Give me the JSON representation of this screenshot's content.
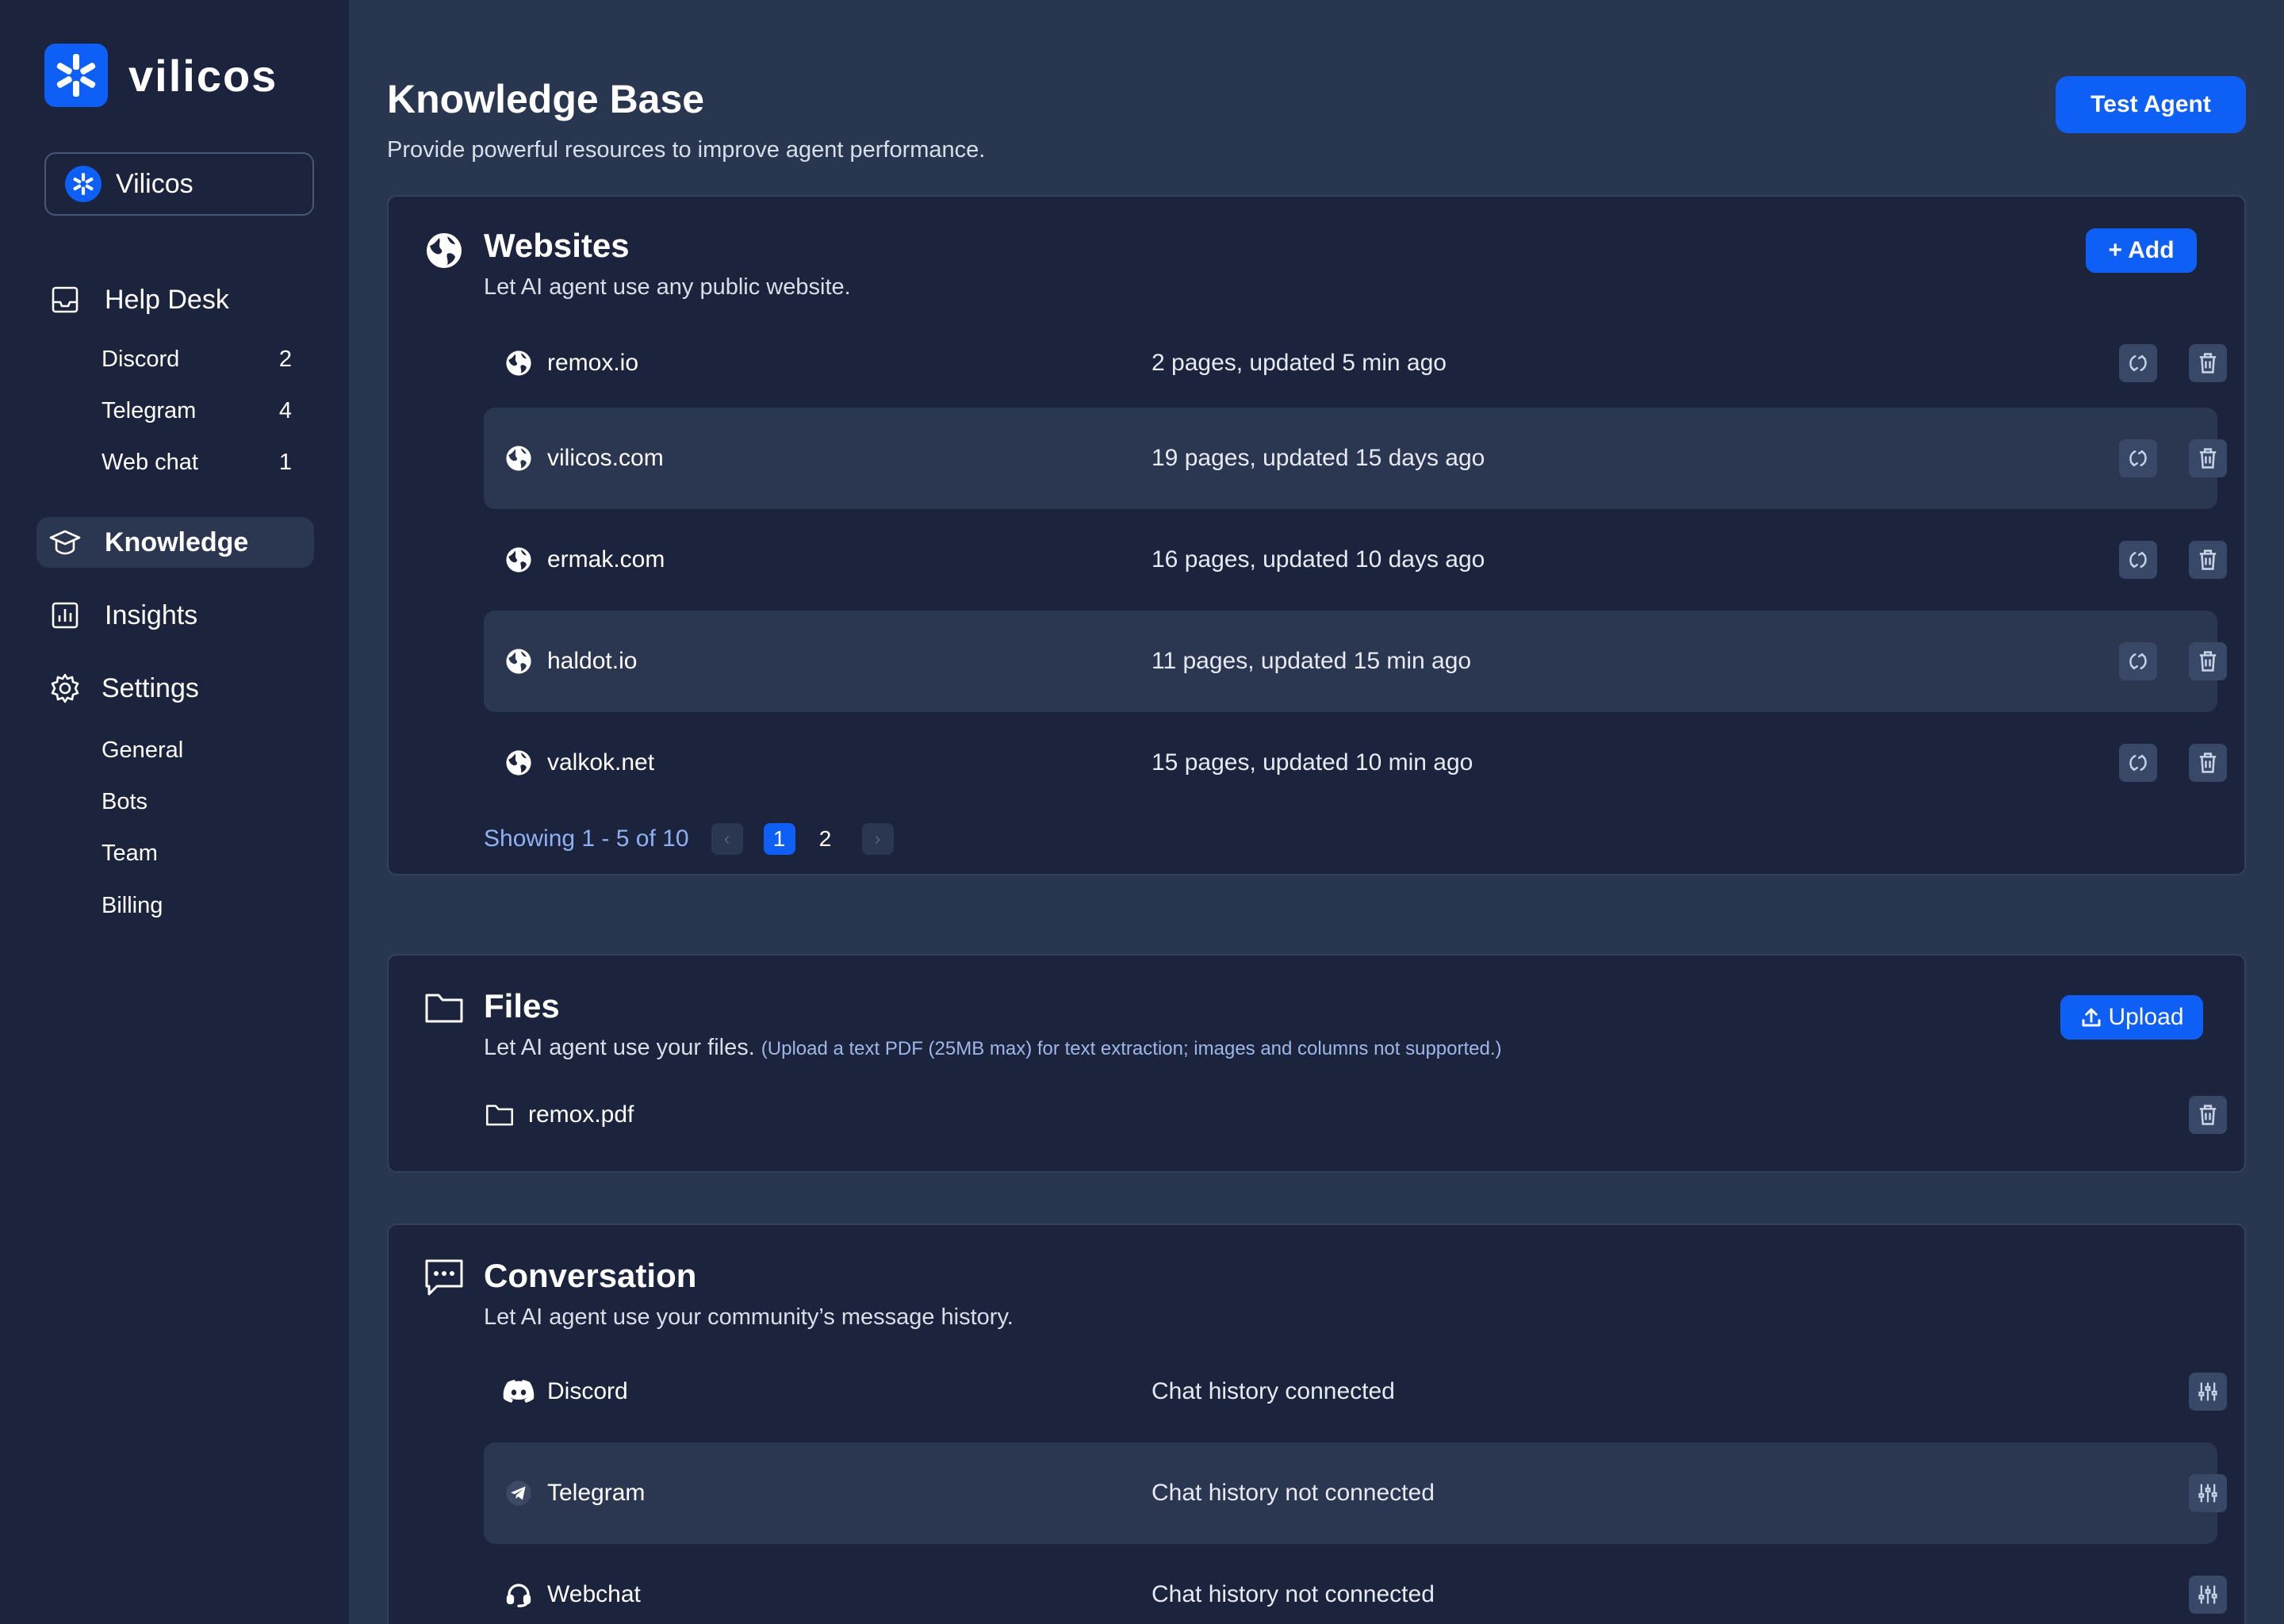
{
  "brand": {
    "name": "vilicos",
    "accent": "#0e5ff5"
  },
  "workspace": {
    "name": "Vilicos"
  },
  "sidebar": {
    "help_desk": {
      "label": "Help Desk",
      "items": [
        {
          "label": "Discord",
          "count": "2"
        },
        {
          "label": "Telegram",
          "count": "4"
        },
        {
          "label": "Web chat",
          "count": "1"
        }
      ]
    },
    "knowledge": {
      "label": "Knowledge"
    },
    "insights": {
      "label": "Insights"
    },
    "settings": {
      "label": "Settings",
      "items": [
        {
          "label": "General"
        },
        {
          "label": "Bots"
        },
        {
          "label": "Team"
        },
        {
          "label": "Billing"
        }
      ]
    }
  },
  "header": {
    "title": "Knowledge Base",
    "subtitle": "Provide powerful resources to improve agent performance.",
    "test_agent_label": "Test Agent"
  },
  "websites": {
    "title": "Websites",
    "description": "Let AI agent use any public website.",
    "add_label": "+ Add",
    "rows": [
      {
        "name": "remox.io",
        "meta": "2 pages, updated 5 min ago"
      },
      {
        "name": "vilicos.com",
        "meta": "19 pages, updated 15 days ago"
      },
      {
        "name": "ermak.com",
        "meta": "16 pages, updated 10 days ago"
      },
      {
        "name": "haldot.io",
        "meta": "11 pages, updated 15 min ago"
      },
      {
        "name": "valkok.net",
        "meta": "15 pages, updated 10 min ago"
      }
    ],
    "pagination": {
      "summary": "Showing 1 - 5 of 10",
      "prev": "‹",
      "next": "›",
      "pages": [
        "1",
        "2"
      ],
      "current": "1"
    }
  },
  "files": {
    "title": "Files",
    "description": "Let AI agent use your files.",
    "note": "(Upload a text PDF (25MB max) for text extraction; images and columns not supported.)",
    "upload_label": "Upload",
    "rows": [
      {
        "name": "remox.pdf"
      }
    ]
  },
  "conversation": {
    "title": "Conversation",
    "description": "Let AI agent use your community’s message history.",
    "rows": [
      {
        "name": "Discord",
        "status": "Chat history connected",
        "icon": "discord-icon"
      },
      {
        "name": "Telegram",
        "status": "Chat history not connected",
        "icon": "telegram-icon"
      },
      {
        "name": "Webchat",
        "status": "Chat history not connected",
        "icon": "headset-icon"
      }
    ]
  }
}
